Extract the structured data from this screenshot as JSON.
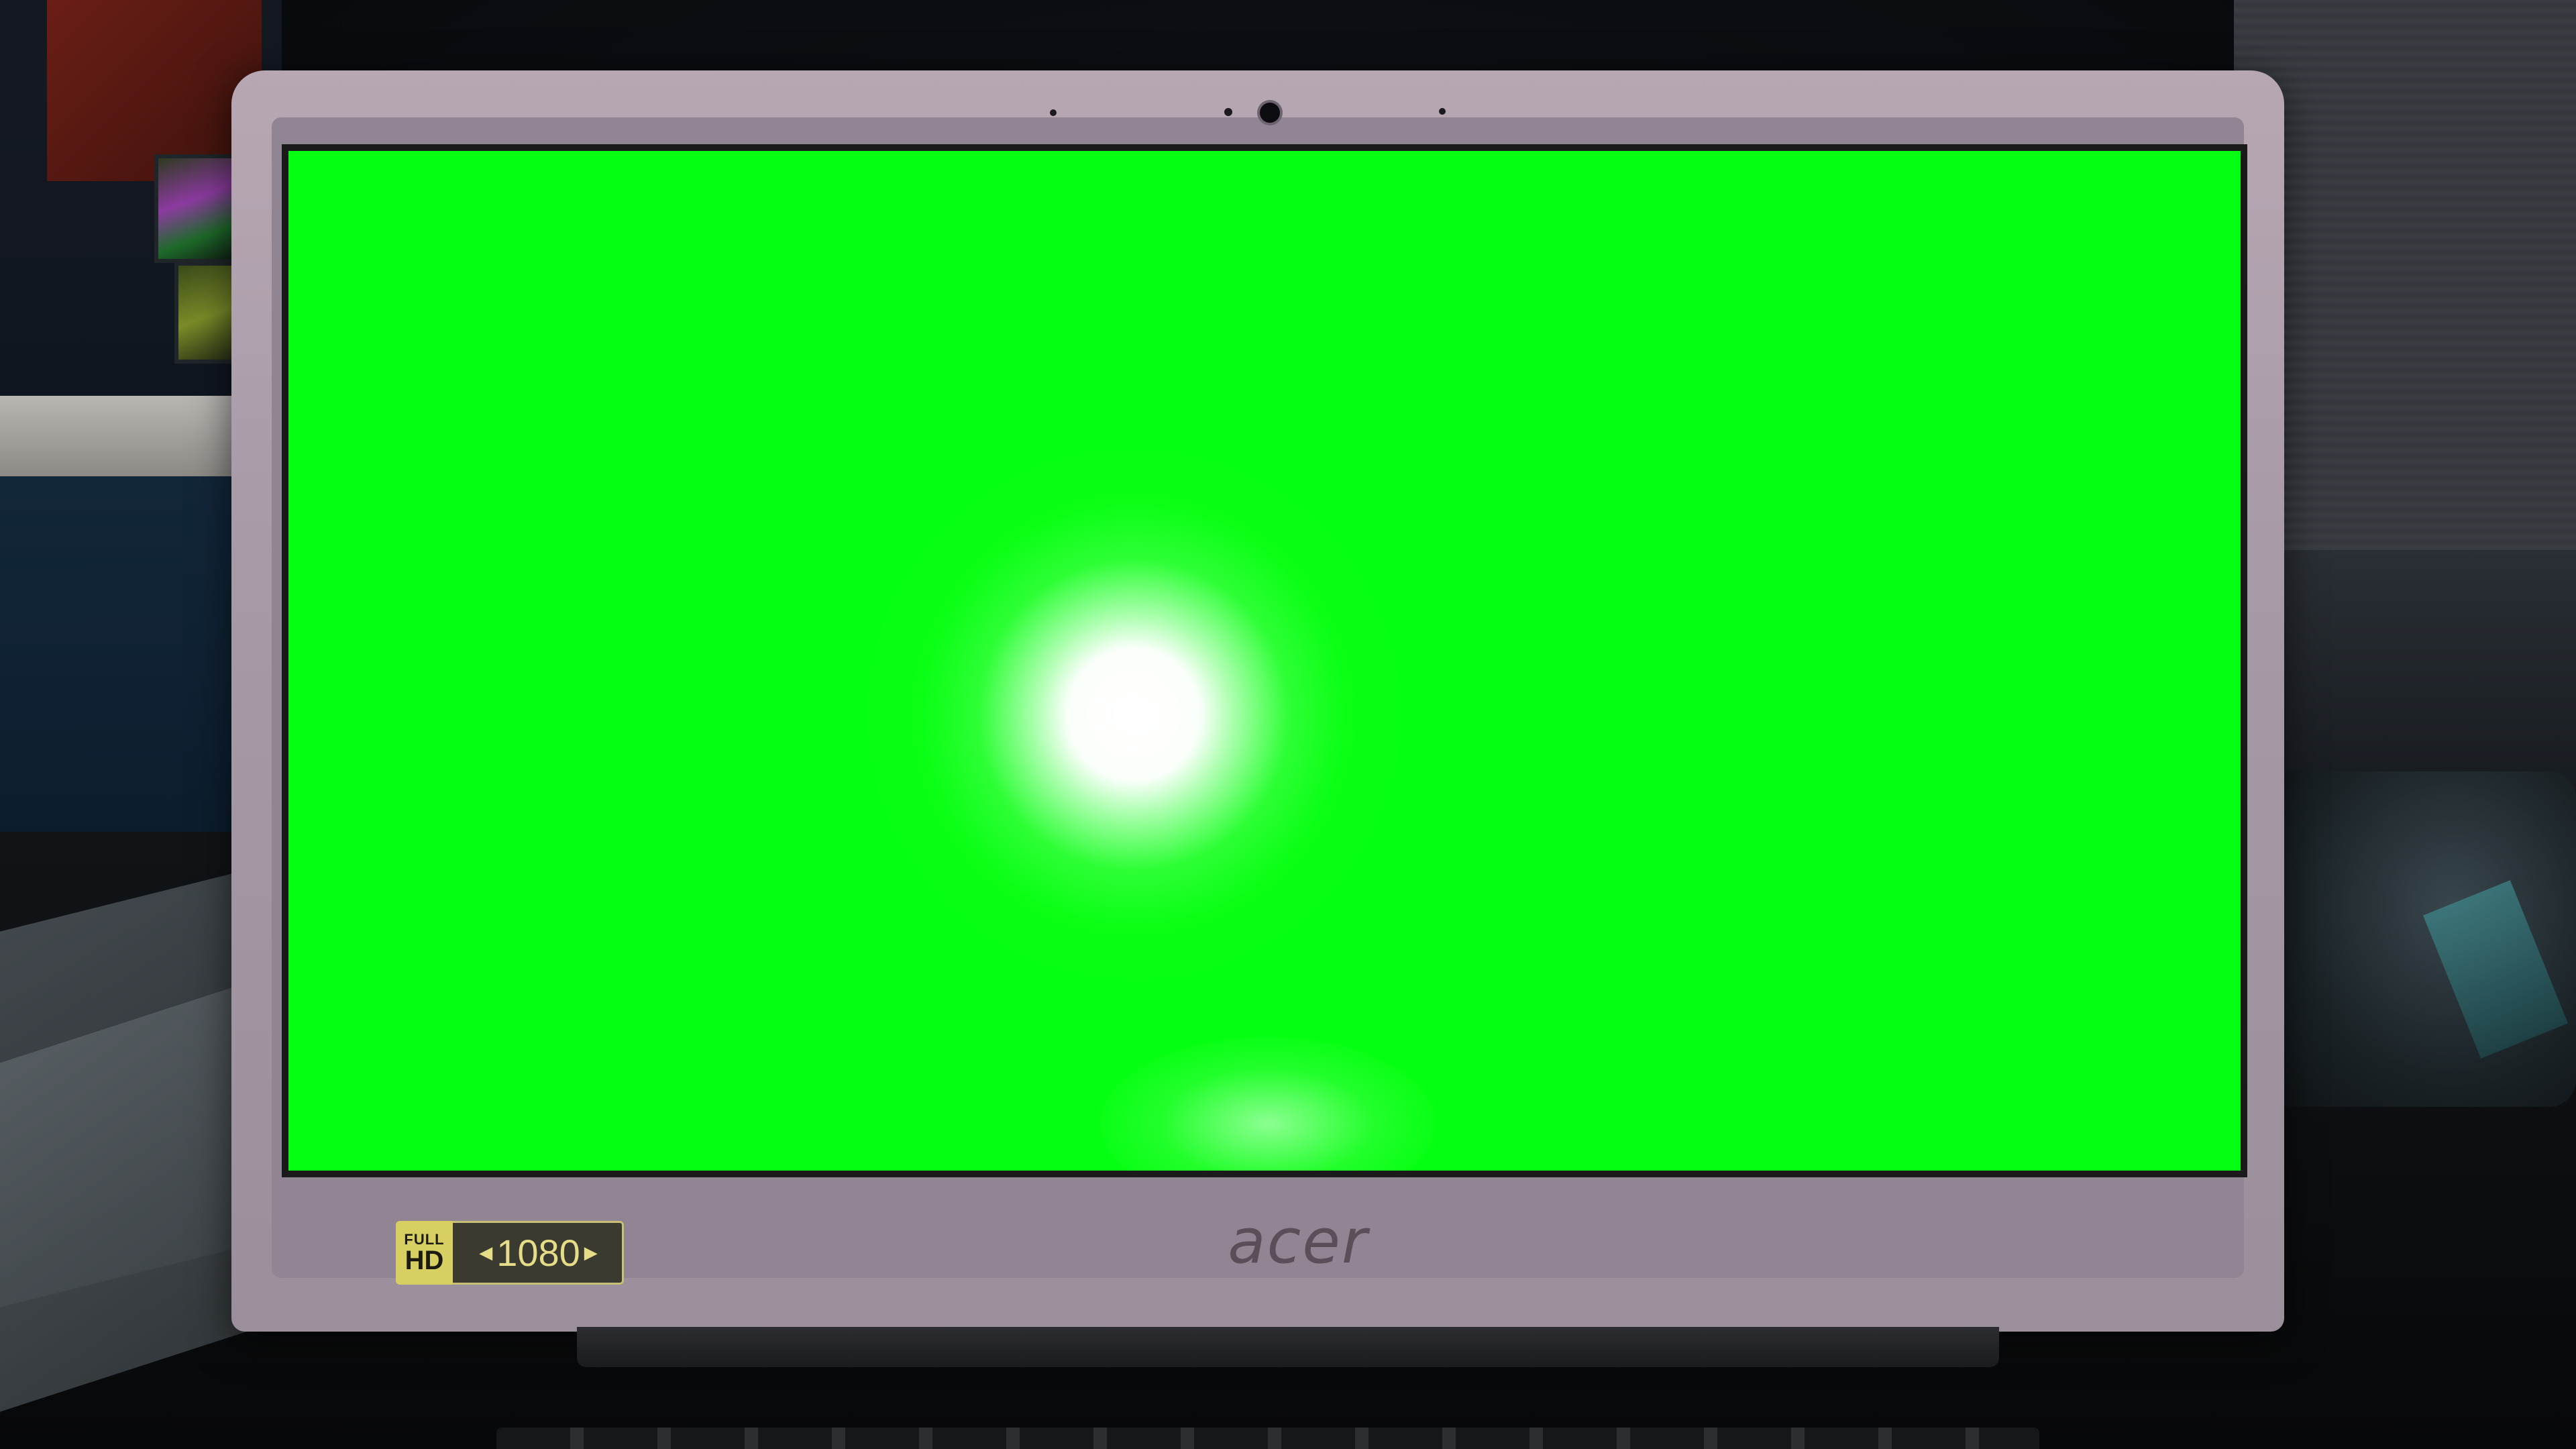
{
  "scene": {
    "description_kind": "photo-of-laptop-displaying-solid-green-screen"
  },
  "laptop": {
    "brand": "acer",
    "badge": {
      "full": "FULL",
      "hd": "HD",
      "resolution": "1080"
    },
    "screen_color": "#05ff12"
  },
  "colors": {
    "screen": "#05ff12",
    "bezel": "#a69aa6",
    "badge_gold": "#d8cf63"
  }
}
